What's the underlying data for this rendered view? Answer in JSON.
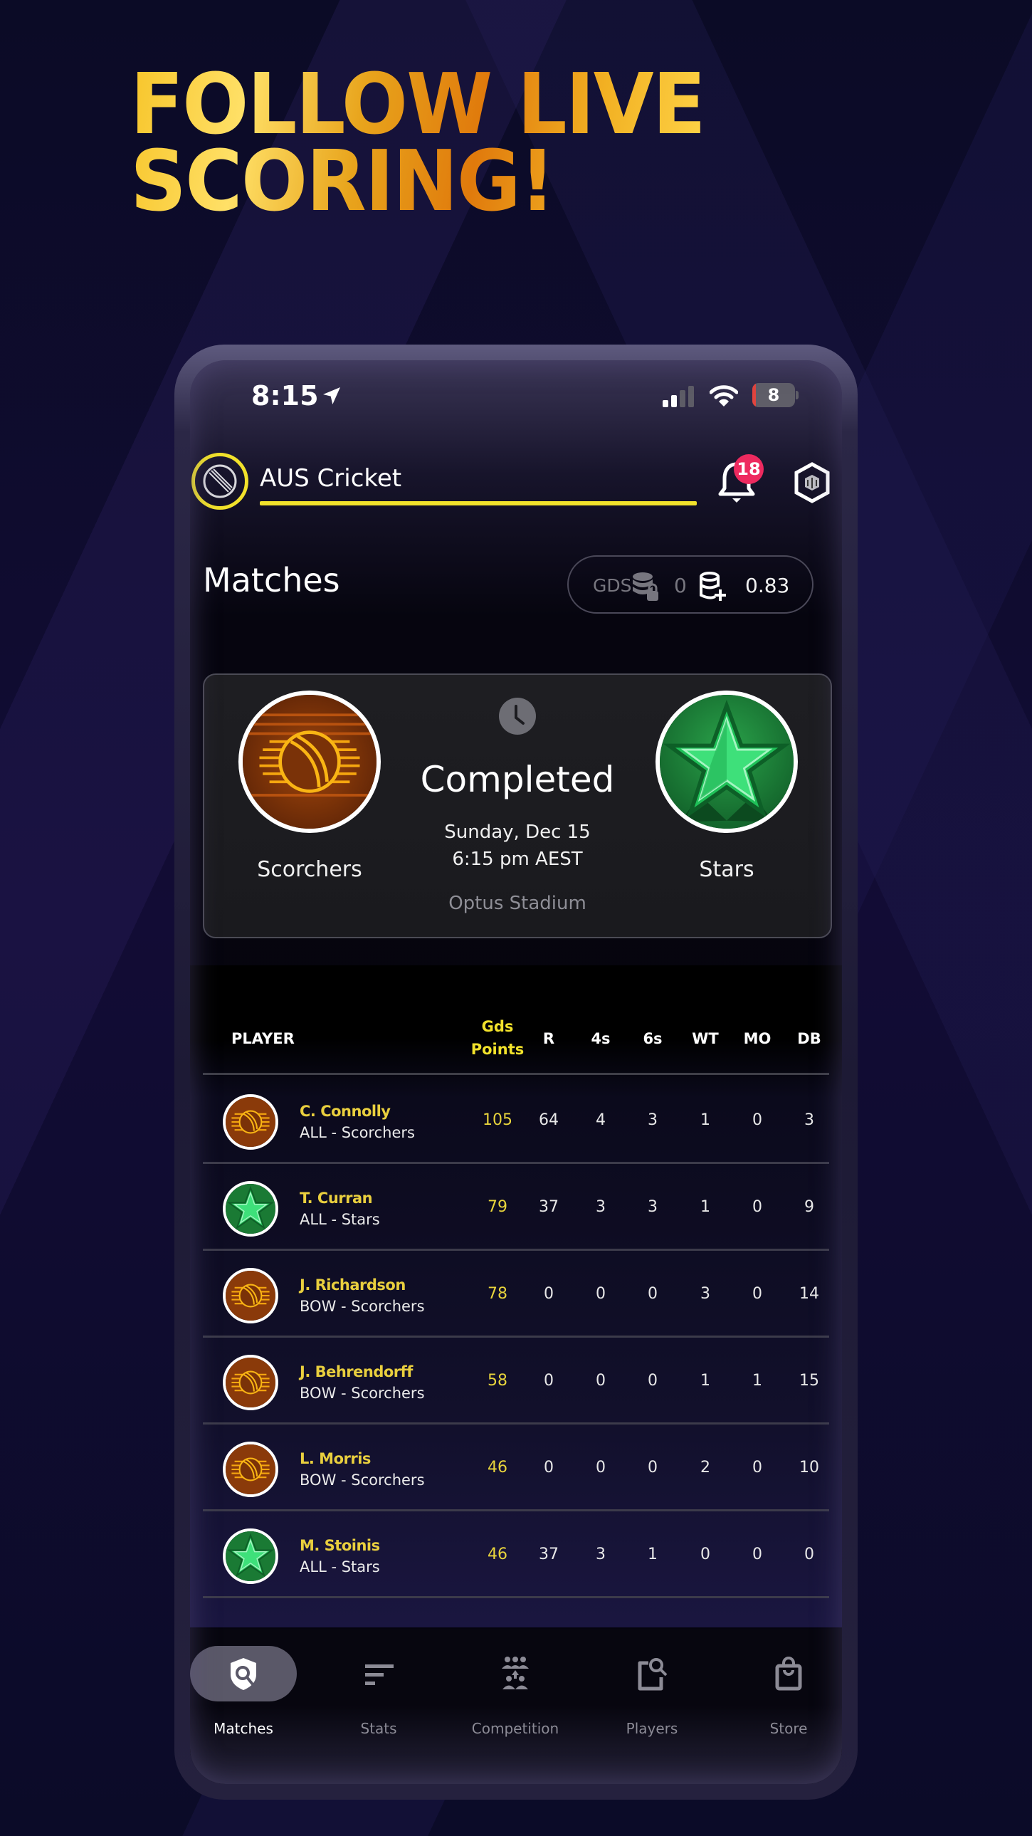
{
  "headline": {
    "line1": "FOLLOW LIVE",
    "line2": "SCORING!"
  },
  "status_bar": {
    "time": "8:15",
    "battery_level": "8",
    "battery_fraction": 0.08,
    "icons": [
      "location-arrow-icon",
      "cellular-signal-icon",
      "wifi-icon",
      "battery-icon"
    ]
  },
  "app_header": {
    "league_title": "AUS Cricket",
    "notification_count": "18",
    "icons": [
      "cricket-ball-logo-icon",
      "bell-icon",
      "brand-hexagon-icon"
    ]
  },
  "page": {
    "title": "Matches"
  },
  "wallet": {
    "currency_label": "GDS",
    "locked_amount": "0",
    "available_amount": "0.83",
    "icons": [
      "coins-lock-icon",
      "coins-plus-icon"
    ]
  },
  "match": {
    "status": "Completed",
    "date": "Sunday, Dec 15",
    "time": "6:15 pm AEST",
    "venue": "Optus Stadium",
    "home_team": "Scorchers",
    "away_team": "Stars",
    "colors": {
      "scorchers": "#8a3a0a",
      "stars": "#1d8a3a"
    }
  },
  "table": {
    "headers": {
      "player": "PLAYER",
      "gds_line1": "Gds",
      "gds_line2": "Points",
      "r": "R",
      "fours": "4s",
      "sixes": "6s",
      "wt": "WT",
      "mo": "MO",
      "db": "DB"
    },
    "rows": [
      {
        "name": "C. Connolly",
        "role": "ALL - Scorchers",
        "team": "scorchers",
        "gds": "105",
        "r": "64",
        "fours": "4",
        "sixes": "3",
        "wt": "1",
        "mo": "0",
        "db": "3"
      },
      {
        "name": "T. Curran",
        "role": "ALL - Stars",
        "team": "stars",
        "gds": "79",
        "r": "37",
        "fours": "3",
        "sixes": "3",
        "wt": "1",
        "mo": "0",
        "db": "9"
      },
      {
        "name": "J. Richardson",
        "role": "BOW - Scorchers",
        "team": "scorchers",
        "gds": "78",
        "r": "0",
        "fours": "0",
        "sixes": "0",
        "wt": "3",
        "mo": "0",
        "db": "14"
      },
      {
        "name": "J. Behrendorff",
        "role": "BOW - Scorchers",
        "team": "scorchers",
        "gds": "58",
        "r": "0",
        "fours": "0",
        "sixes": "0",
        "wt": "1",
        "mo": "1",
        "db": "15"
      },
      {
        "name": "L. Morris",
        "role": "BOW - Scorchers",
        "team": "scorchers",
        "gds": "46",
        "r": "0",
        "fours": "0",
        "sixes": "0",
        "wt": "2",
        "mo": "0",
        "db": "10"
      },
      {
        "name": "M. Stoinis",
        "role": "ALL - Stars",
        "team": "stars",
        "gds": "46",
        "r": "37",
        "fours": "3",
        "sixes": "1",
        "wt": "0",
        "mo": "0",
        "db": "0"
      }
    ]
  },
  "bottom_nav": {
    "items": [
      {
        "label": "Matches",
        "icon": "shield-search-icon",
        "active": true
      },
      {
        "label": "Stats",
        "icon": "stats-bars-icon",
        "active": false
      },
      {
        "label": "Competition",
        "icon": "competition-group-icon",
        "active": false
      },
      {
        "label": "Players",
        "icon": "player-search-icon",
        "active": false
      },
      {
        "label": "Store",
        "icon": "shopping-bag-icon",
        "active": false
      }
    ]
  },
  "colors": {
    "accent_yellow": "#f2e22b",
    "badge_red": "#ee2a5f",
    "gold_text": "#e9cf3e"
  }
}
